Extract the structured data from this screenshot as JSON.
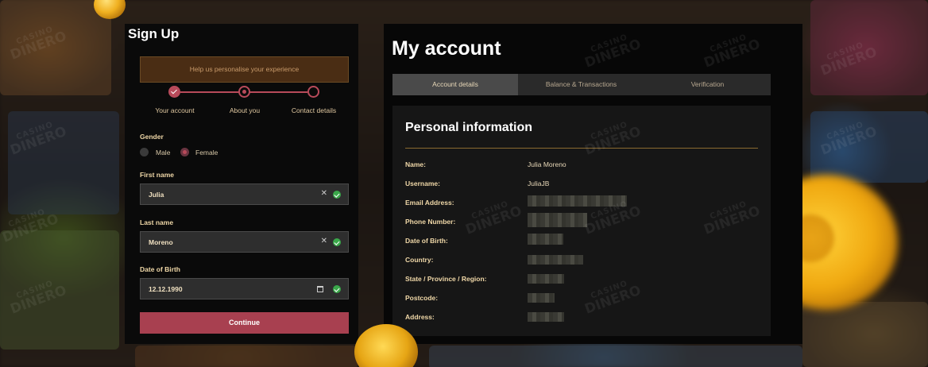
{
  "signup": {
    "title": "Sign Up",
    "hint": "Help us personalise your experience",
    "steps": [
      {
        "label": "Your account",
        "state": "done"
      },
      {
        "label": "About you",
        "state": "active"
      },
      {
        "label": "Contact details",
        "state": "pending"
      }
    ],
    "gender_label": "Gender",
    "gender_options": [
      "Male",
      "Female"
    ],
    "gender_selected": "Female",
    "first_name_label": "First name",
    "first_name_value": "Julia",
    "last_name_label": "Last name",
    "last_name_value": "Moreno",
    "dob_label": "Date of Birth",
    "dob_value": "12.12.1990",
    "continue_label": "Continue",
    "clear_glyph": "✕"
  },
  "account": {
    "title": "My account",
    "tabs": [
      "Account details",
      "Balance & Transactions",
      "Verification"
    ],
    "active_tab": "Account details",
    "section_title": "Personal information",
    "rows": [
      {
        "label": "Name:",
        "value": "Julia Moreno"
      },
      {
        "label": "Username:",
        "value": "JuliaJB"
      },
      {
        "label": "Email Address:",
        "value": ""
      },
      {
        "label": "Phone Number:",
        "value": ""
      },
      {
        "label": "Date of Birth:",
        "value": ""
      },
      {
        "label": "Country:",
        "value": ""
      },
      {
        "label": "State / Province / Region:",
        "value": ""
      },
      {
        "label": "Postcode:",
        "value": ""
      },
      {
        "label": "Address:",
        "value": ""
      }
    ]
  },
  "watermark": {
    "line1": "CASINO",
    "line2": "DINERO"
  },
  "colors": {
    "accent": "#b84a5a",
    "gold": "#f0d8a8",
    "panel": "#0a0a0a"
  }
}
